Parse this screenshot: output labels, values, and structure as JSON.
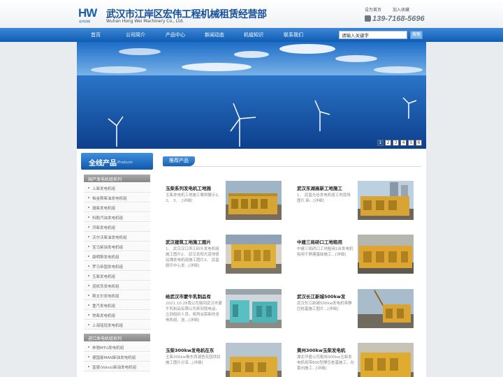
{
  "header": {
    "logo_text": "HW",
    "logo_sub": "宏伟机械",
    "company_name": "武汉市江岸区宏伟工程机械租赁经营部",
    "company_name_en": "Wuhan Hong Wei Machinery Co., Ltd.",
    "set_home": "设为首页",
    "add_favorite": "加入收藏",
    "phone": "139-7168-5696"
  },
  "nav": {
    "items": [
      "首页",
      "公司简介",
      "产品中心",
      "新闻动态",
      "机组知识",
      "联系我们"
    ],
    "search_placeholder": "请输入关键字",
    "search_button": "搜索"
  },
  "banner": {
    "pages": [
      "1",
      "2",
      "3",
      "4",
      "5",
      "6"
    ],
    "active_page": "1"
  },
  "sidebar": {
    "title": "全线产品",
    "title_en": "Products",
    "domestic_label": "国产发电机组系列",
    "domestic_items": [
      "上柴发电机组",
      "帕金斯柴油发电机组",
      "潍柴发电机组",
      "科勒汽油发电机组",
      "济柴发电机组",
      "沃尔沃柴油发电机组",
      "宝马柴油发电机组",
      "康明斯发电机组",
      "罗马帝国发电机组",
      "玉柴发电机组",
      "道依茨发电机组",
      "斯太尔发电机组",
      "重汽发电机组",
      "常柴发电机组",
      "上海铭冠发电机组"
    ],
    "imported_label": "进口发电机组系列",
    "imported_items": [
      "奔驰MTU发电机组",
      "德国曼MAN柴油发电机组",
      "富豪(Volvo)柴油发电机组"
    ]
  },
  "main": {
    "section_title": "推荐产品",
    "products": [
      {
        "title": "玉柴系列发电机工地施",
        "desc": "玉柴发电机工地施工案例展示1、 2、 3、 .[详细]"
      },
      {
        "title": "武汉东湖高新工地施工",
        "desc": "1、 武昌光谷发电机组工地现场图片,新...[详细]"
      },
      {
        "title": "武汉建筑工地施工图片",
        "desc": "1、 武汉汉口滨江码头发电机组施工图片2、 武汉龙阳大道地铁站铺发电机组施工图片3、 武昌娱乐中心发...[详细]"
      },
      {
        "title": "中建三局硚口工地租用",
        "desc": "中建三局硚口工地租用1台发电机组用于屏建基础施工...[详细]"
      },
      {
        "title": "给武汉市蒙牛乳制品有",
        "desc": "2021.10.28我公司接到武汉市蒙牛乳制品有限公司来到我电话，立刻组织人员，将两台崭新的发电机组，送...[详细]"
      },
      {
        "title": "武汉长江新城500kw发",
        "desc": "武汉长江新城500kw发电机带静压桩基施工图片...[详细]"
      },
      {
        "title": "玉柴300kw发电机在东",
        "desc": "玉柴300kw做东西湖吾花园项目施工图片分享...[详细]"
      },
      {
        "title": "黄州300kw玉柴发电机",
        "desc": "湖北华盛公司租用300kw玉柴发电机组带800型静压桩基施工，在黄州施工...[详细]"
      }
    ]
  },
  "colors": {
    "brand_blue": "#1158ad",
    "nav_blue": "#0f5cb3"
  }
}
